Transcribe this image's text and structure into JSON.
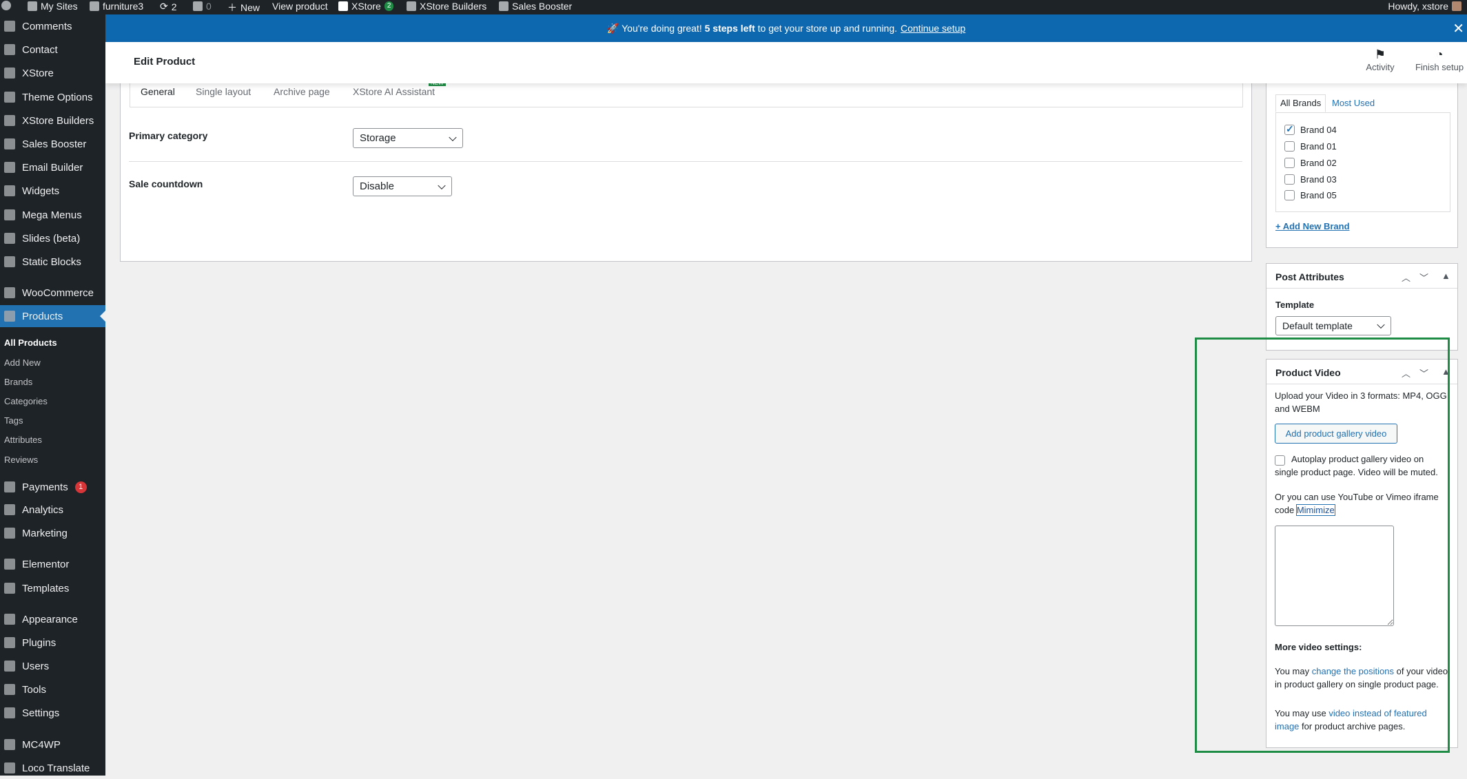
{
  "admin_bar": {
    "items": [
      "My Sites",
      "furniture3",
      "2",
      "0",
      "New",
      "View product",
      "XStore",
      "XStore Builders",
      "Sales Booster"
    ],
    "xstore_badge": "2",
    "howdy": "Howdy, xstore"
  },
  "sidebar": {
    "items": [
      "Comments",
      "Contact",
      "XStore",
      "Theme Options",
      "XStore Builders",
      "Sales Booster",
      "Email Builder",
      "Widgets",
      "Mega Menus",
      "Slides (beta)",
      "Static Blocks",
      "WooCommerce",
      "Products",
      "Payments",
      "Analytics",
      "Marketing",
      "Elementor",
      "Templates",
      "Appearance",
      "Plugins",
      "Users",
      "Tools",
      "Settings",
      "MC4WP",
      "Loco Translate"
    ],
    "submenu": [
      "All Products",
      "Add New",
      "Brands",
      "Categories",
      "Tags",
      "Attributes",
      "Reviews"
    ],
    "payments_badge": "1"
  },
  "notice": {
    "icon": "rocket",
    "pre": "You're doing great!",
    "bold": "5 steps left",
    "post": "to get your store up and running.",
    "link": "Continue setup"
  },
  "header": {
    "title": "Edit Product",
    "activity": "Activity",
    "finish_setup": "Finish setup"
  },
  "product_tabs": {
    "tabs": [
      "General",
      "Single layout",
      "Archive page",
      "XStore AI Assistant"
    ],
    "new_badge": "NEW",
    "active": "General"
  },
  "fields": {
    "primary_category_label": "Primary category",
    "primary_category_value": "Storage",
    "sale_countdown_label": "Sale countdown",
    "sale_countdown_value": "Disable"
  },
  "brands": {
    "tabs": [
      "All Brands",
      "Most Used"
    ],
    "items": [
      {
        "label": "Brand 04",
        "checked": true
      },
      {
        "label": "Brand 01",
        "checked": false
      },
      {
        "label": "Brand 02",
        "checked": false
      },
      {
        "label": "Brand 03",
        "checked": false
      },
      {
        "label": "Brand 05",
        "checked": false
      }
    ],
    "add_new": "+ Add New Brand"
  },
  "post_attributes": {
    "title": "Post Attributes",
    "template_label": "Template",
    "template_value": "Default template"
  },
  "product_video": {
    "title": "Product Video",
    "upload_text": "Upload your Video in 3 formats: MP4, OGG and WEBM",
    "add_button": "Add product gallery video",
    "autoplay_label": "Autoplay product gallery video on single product page. Video will be muted.",
    "iframe_text": "Or you can use YouTube or Vimeo iframe code",
    "minimize": "Mimimize",
    "more_settings": "More video settings:",
    "p1_pre": "You may",
    "p1_link": "change the positions",
    "p1_post": "of your video in product gallery on single product page.",
    "p2_pre": "You may use",
    "p2_link": "video instead of featured image",
    "p2_post": "for product archive pages."
  },
  "colors": {
    "highlight": "#1e8c45",
    "accent": "#2271b1",
    "notice": "#0e68b0"
  }
}
